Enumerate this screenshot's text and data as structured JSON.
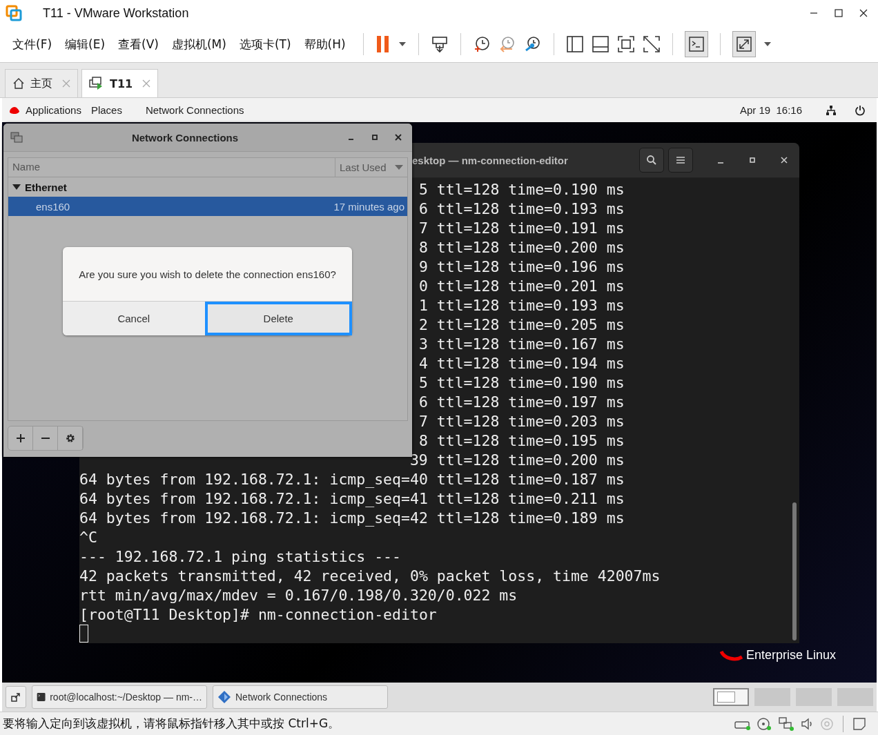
{
  "window": {
    "title": "T11 - VMware Workstation"
  },
  "menu": [
    "文件(F)",
    "编辑(E)",
    "查看(V)",
    "虚拟机(M)",
    "选项卡(T)",
    "帮助(H)"
  ],
  "toolbar": {
    "console_view_on": true,
    "autofit_on": true
  },
  "tabs": [
    {
      "label": "主页",
      "selected": false
    },
    {
      "label": "T11",
      "selected": true
    }
  ],
  "gnome_top_bar": {
    "menus": [
      "Applications",
      "Places",
      "Network Connections"
    ],
    "clock": "Apr 19  16:16"
  },
  "terminal": {
    "title": "esktop — nm-connection-editor",
    "lines": [
      {
        "kind": "partial",
        "text": "5 ttl=128 time=0.190 ms"
      },
      {
        "kind": "partial",
        "text": "6 ttl=128 time=0.193 ms"
      },
      {
        "kind": "partial",
        "text": "7 ttl=128 time=0.191 ms"
      },
      {
        "kind": "partial",
        "text": "8 ttl=128 time=0.200 ms"
      },
      {
        "kind": "partial",
        "text": "9 ttl=128 time=0.196 ms"
      },
      {
        "kind": "partial",
        "text": "0 ttl=128 time=0.201 ms"
      },
      {
        "kind": "partial",
        "text": "1 ttl=128 time=0.193 ms"
      },
      {
        "kind": "partial",
        "text": "2 ttl=128 time=0.205 ms"
      },
      {
        "kind": "partial",
        "text": "3 ttl=128 time=0.167 ms"
      },
      {
        "kind": "partial",
        "text": "4 ttl=128 time=0.194 ms"
      },
      {
        "kind": "partial",
        "text": "5 ttl=128 time=0.190 ms"
      },
      {
        "kind": "partial",
        "text": "6 ttl=128 time=0.197 ms"
      },
      {
        "kind": "partial",
        "text": "7 ttl=128 time=0.203 ms"
      },
      {
        "kind": "partial",
        "text": "8 ttl=128 time=0.195 ms"
      },
      {
        "kind": "partial",
        "text": "39 ttl=128 time=0.200 ms"
      },
      {
        "kind": "full",
        "text": "64 bytes from 192.168.72.1: icmp_seq=40 ttl=128 time=0.187 ms"
      },
      {
        "kind": "full",
        "text": "64 bytes from 192.168.72.1: icmp_seq=41 ttl=128 time=0.211 ms"
      },
      {
        "kind": "full",
        "text": "64 bytes from 192.168.72.1: icmp_seq=42 ttl=128 time=0.189 ms"
      },
      {
        "kind": "full",
        "text": "^C"
      },
      {
        "kind": "full",
        "text": "--- 192.168.72.1 ping statistics ---"
      },
      {
        "kind": "full",
        "text": "42 packets transmitted, 42 received, 0% packet loss, time 42007ms"
      },
      {
        "kind": "full",
        "text": "rtt min/avg/max/mdev = 0.167/0.198/0.320/0.022 ms"
      },
      {
        "kind": "full",
        "text": "[root@T11 Desktop]# nm-connection-editor"
      }
    ]
  },
  "network_connections": {
    "title": "Network Connections",
    "columns": [
      "Name",
      "Last Used"
    ],
    "groups": [
      {
        "label": "Ethernet",
        "expanded": true,
        "children": [
          {
            "name": "ens160",
            "last_used": "17 minutes ago",
            "selected": true
          }
        ]
      }
    ]
  },
  "confirm_dialog": {
    "message": "Are you sure you wish to delete the connection ens160?",
    "buttons": [
      {
        "label": "Cancel",
        "focused": false
      },
      {
        "label": "Delete",
        "focused": true
      }
    ]
  },
  "desktop": {
    "logo_text": "Enterprise Linux"
  },
  "taskbar": {
    "tasks": [
      {
        "kind": "terminal",
        "label": "root@localhost:~/Desktop — nm-…"
      },
      {
        "kind": "network",
        "label": "Network Connections"
      }
    ],
    "workspaces": [
      {
        "selected": true
      },
      {
        "selected": false
      },
      {
        "selected": false
      },
      {
        "selected": false
      }
    ]
  },
  "status_bar": {
    "message": "要将输入定向到该虚拟机，请将鼠标指针移入其中或按 Ctrl+G。"
  }
}
